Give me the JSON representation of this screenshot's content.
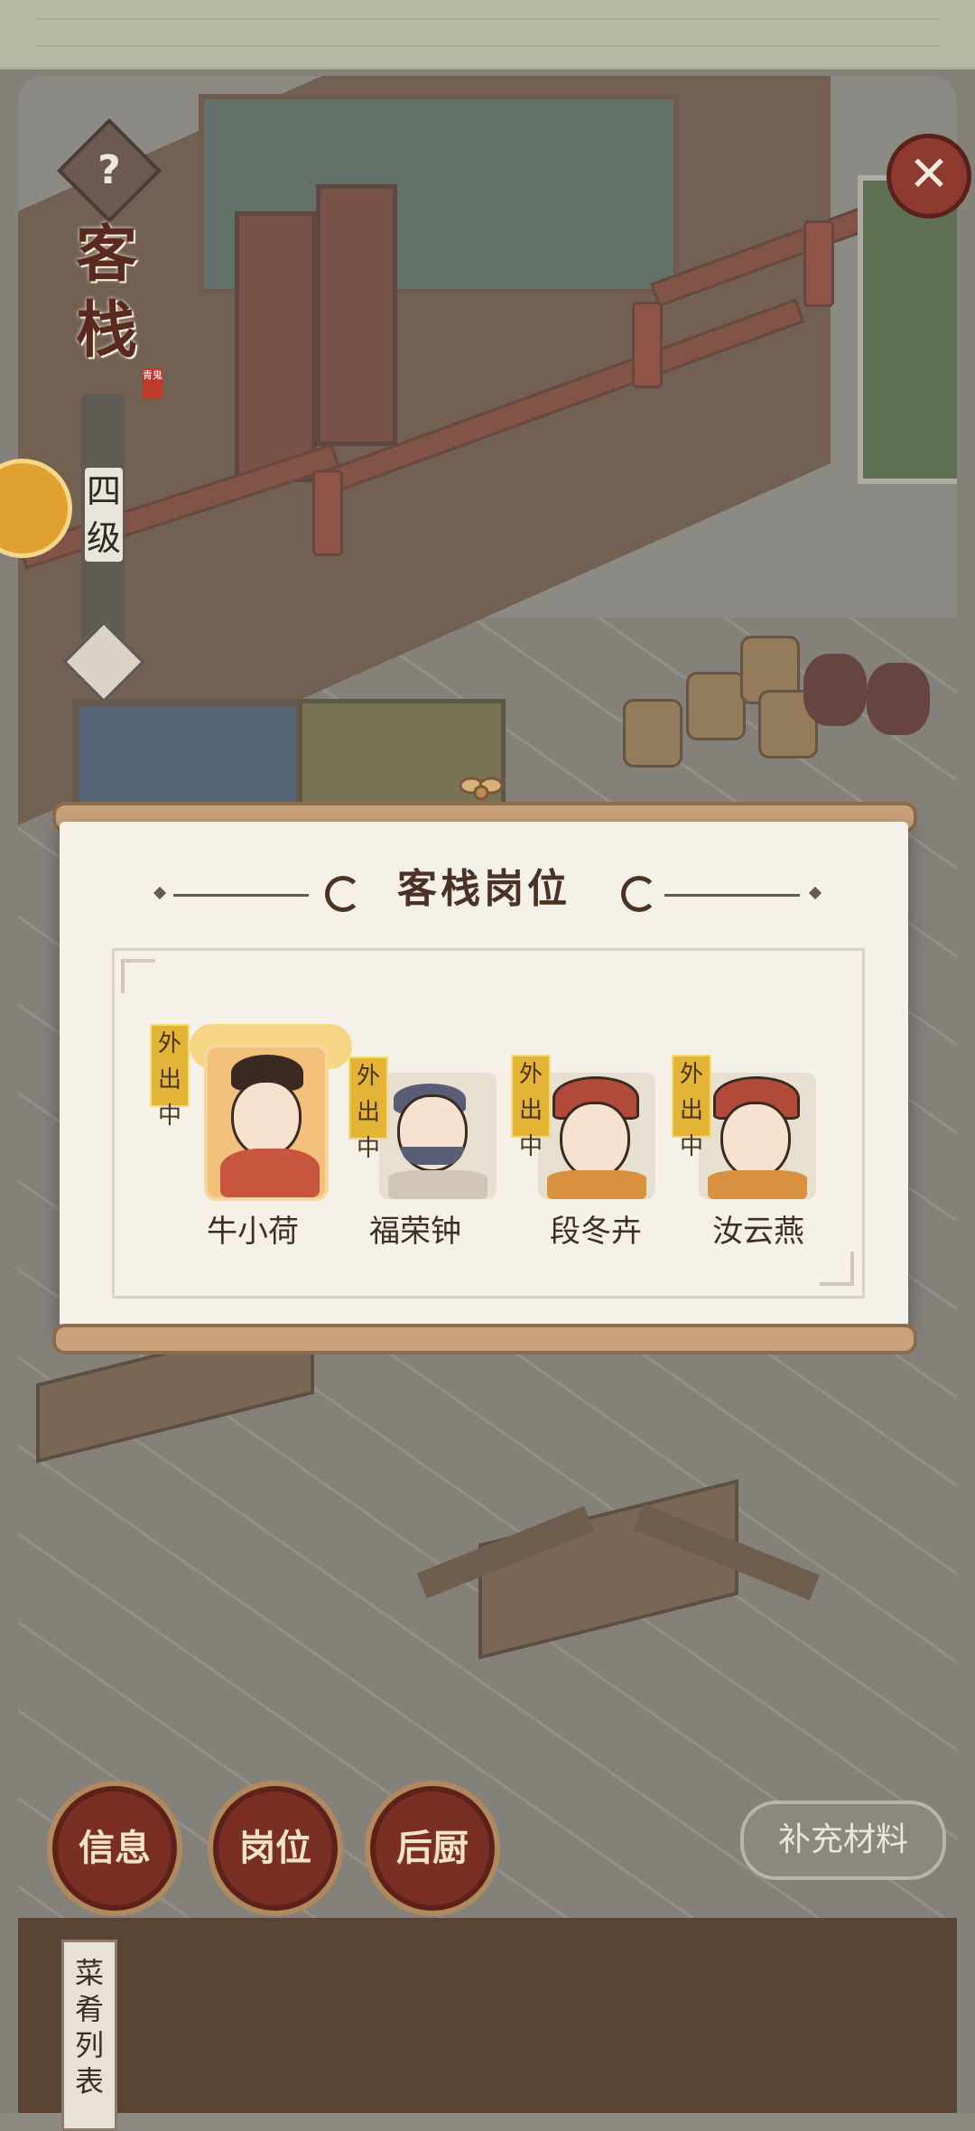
{
  "header": {
    "title_chars": [
      "客",
      "栈"
    ],
    "seal_text": "青鬼",
    "level_chars": [
      "四",
      "级"
    ]
  },
  "icons": {
    "help": "?",
    "close": "✕"
  },
  "panel": {
    "title": "客栈岗位",
    "staff": [
      {
        "name": "牛小荷",
        "status": [
          "外",
          "出",
          "中"
        ],
        "selected": true
      },
      {
        "name": "福荣钟",
        "status": [
          "外",
          "出",
          "中"
        ],
        "selected": false
      },
      {
        "name": "段冬卉",
        "status": [
          "外",
          "出",
          "中"
        ],
        "selected": false
      },
      {
        "name": "汝云燕",
        "status": [
          "外",
          "出",
          "中"
        ],
        "selected": false
      }
    ]
  },
  "bottom": {
    "info_label": "信息",
    "post_label": "岗位",
    "kitchen_label": "后厨",
    "supply_label": "补充材料",
    "menu_tab_chars": [
      "菜",
      "肴",
      "列",
      "表"
    ]
  },
  "colors": {
    "accent": "#7a2f24",
    "tag": "#e3b436",
    "panel": "#f5f1e8"
  }
}
